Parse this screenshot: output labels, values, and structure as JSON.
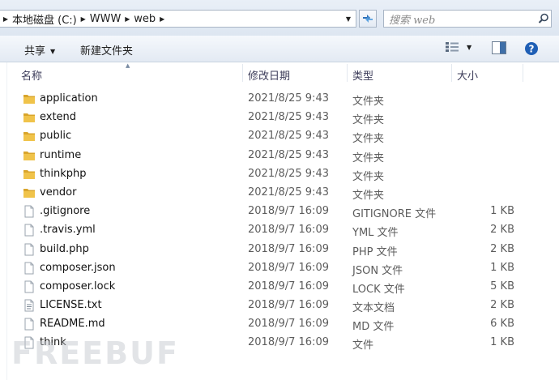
{
  "address_bar": {
    "crumbs": [
      "本地磁盘 (C:)",
      "WWW",
      "web"
    ]
  },
  "search": {
    "placeholder": "搜索 web"
  },
  "toolbar": {
    "share_label": "共享",
    "new_folder_label": "新建文件夹"
  },
  "columns": {
    "name": "名称",
    "modified": "修改日期",
    "type": "类型",
    "size": "大小"
  },
  "files": [
    {
      "name": "application",
      "modified": "2021/8/25 9:43",
      "type": "文件夹",
      "size": "",
      "kind": "folder"
    },
    {
      "name": "extend",
      "modified": "2021/8/25 9:43",
      "type": "文件夹",
      "size": "",
      "kind": "folder"
    },
    {
      "name": "public",
      "modified": "2021/8/25 9:43",
      "type": "文件夹",
      "size": "",
      "kind": "folder"
    },
    {
      "name": "runtime",
      "modified": "2021/8/25 9:43",
      "type": "文件夹",
      "size": "",
      "kind": "folder"
    },
    {
      "name": "thinkphp",
      "modified": "2021/8/25 9:43",
      "type": "文件夹",
      "size": "",
      "kind": "folder"
    },
    {
      "name": "vendor",
      "modified": "2021/8/25 9:43",
      "type": "文件夹",
      "size": "",
      "kind": "folder"
    },
    {
      "name": ".gitignore",
      "modified": "2018/9/7 16:09",
      "type": "GITIGNORE 文件",
      "size": "1 KB",
      "kind": "file"
    },
    {
      "name": ".travis.yml",
      "modified": "2018/9/7 16:09",
      "type": "YML 文件",
      "size": "2 KB",
      "kind": "file"
    },
    {
      "name": "build.php",
      "modified": "2018/9/7 16:09",
      "type": "PHP 文件",
      "size": "2 KB",
      "kind": "file"
    },
    {
      "name": "composer.json",
      "modified": "2018/9/7 16:09",
      "type": "JSON 文件",
      "size": "1 KB",
      "kind": "file"
    },
    {
      "name": "composer.lock",
      "modified": "2018/9/7 16:09",
      "type": "LOCK 文件",
      "size": "5 KB",
      "kind": "file"
    },
    {
      "name": "LICENSE.txt",
      "modified": "2018/9/7 16:09",
      "type": "文本文档",
      "size": "2 KB",
      "kind": "text"
    },
    {
      "name": "README.md",
      "modified": "2018/9/7 16:09",
      "type": "MD 文件",
      "size": "6 KB",
      "kind": "file"
    },
    {
      "name": "think",
      "modified": "2018/9/7 16:09",
      "type": "文件",
      "size": "1 KB",
      "kind": "file"
    }
  ],
  "watermark": "FREEBUF",
  "colors": {
    "folder": "#e8b83a",
    "help_icon": "#1f5fb5",
    "header_text": "#3c3c5a",
    "meta_text": "#5c5c5c"
  },
  "icons": {
    "refresh": "refresh-icon",
    "search": "search-icon",
    "view": "view-options-icon",
    "preview": "preview-pane-icon",
    "help": "help-icon",
    "folder": "folder-icon",
    "file": "file-icon",
    "text": "text-document-icon"
  }
}
